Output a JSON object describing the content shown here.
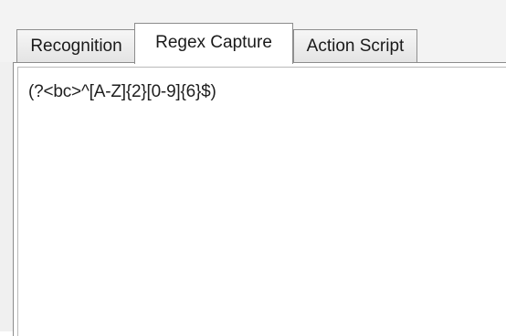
{
  "tabs": [
    {
      "label": "Recognition",
      "selected": false
    },
    {
      "label": "Regex Capture",
      "selected": true
    },
    {
      "label": "Action Script",
      "selected": false
    }
  ],
  "regex_editor": {
    "value": "(?<bc>^[A-Z]{2}[0-9]{6}$)"
  }
}
